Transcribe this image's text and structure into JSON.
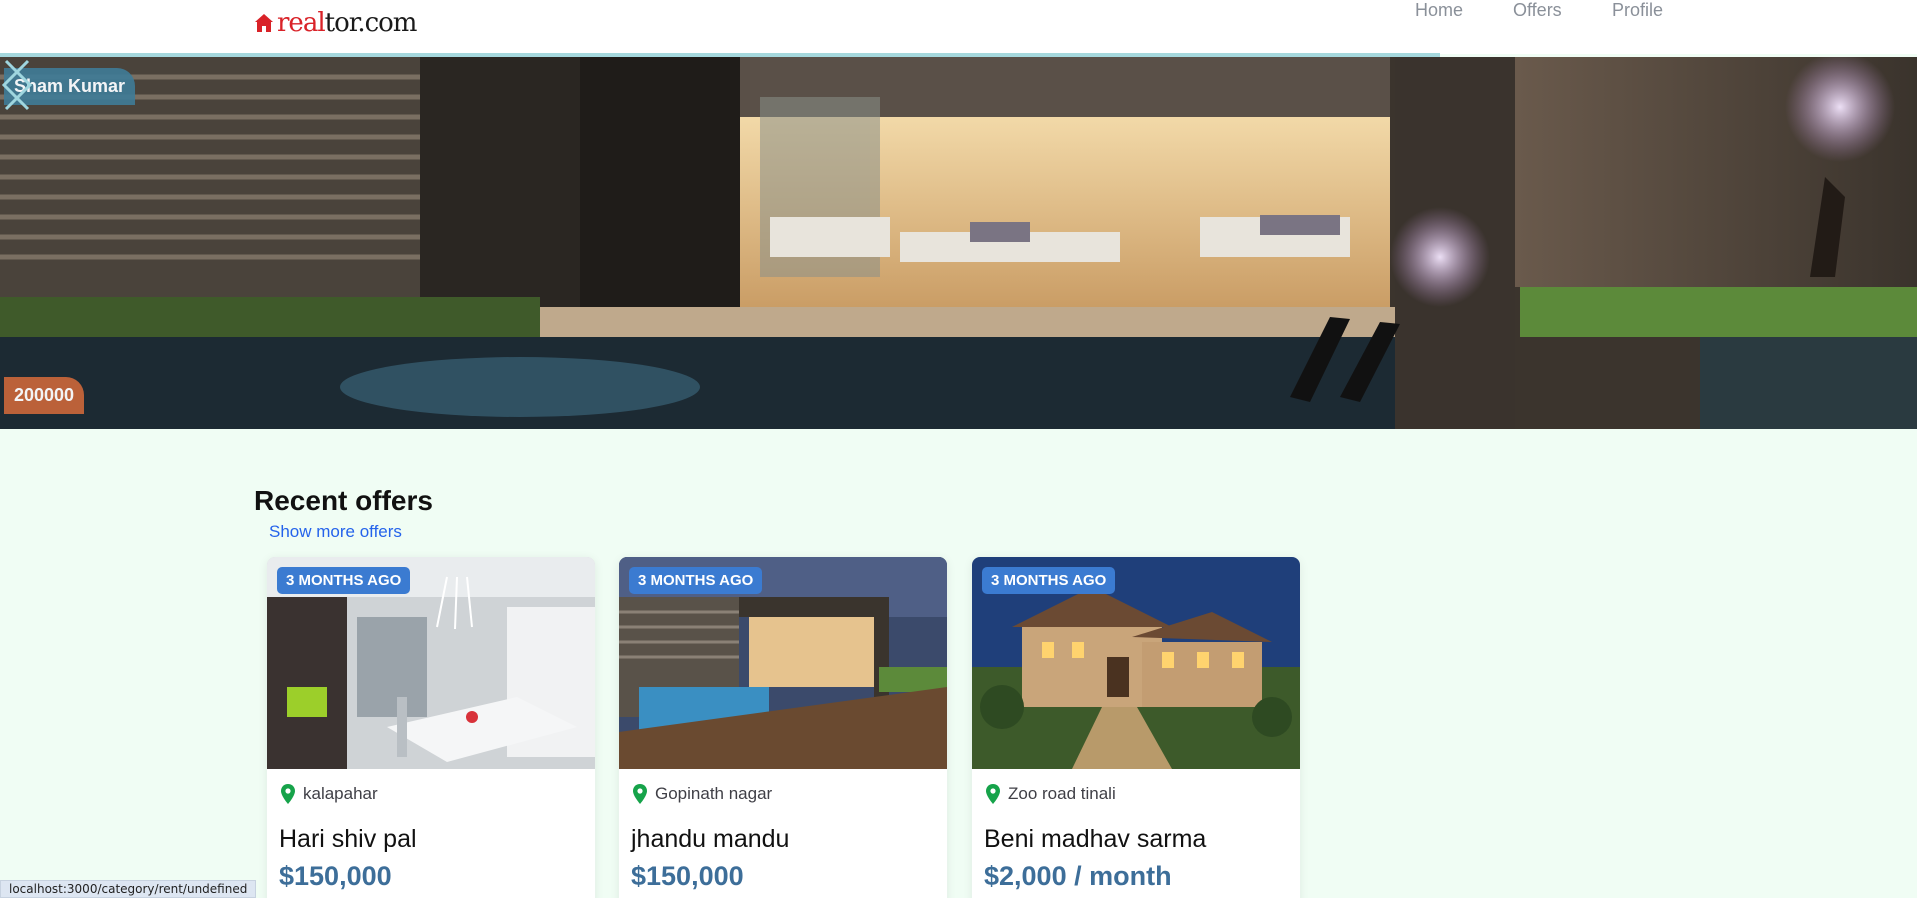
{
  "header": {
    "logo_red": "real",
    "logo_dark": "tor.com",
    "nav": [
      "Home",
      "Offers",
      "Profile"
    ]
  },
  "hero": {
    "name_tag": "Sham Kumar",
    "price_tag": "200000",
    "prev_icon": "chevron-left-icon",
    "next_icon": "chevron-right-icon"
  },
  "offers": {
    "title": "Recent offers",
    "more_link": "Show more offers",
    "cards": [
      {
        "badge": "3 MONTHS AGO",
        "location": "kalapahar",
        "name": "Hari shiv pal",
        "price": "$150,000"
      },
      {
        "badge": "3 MONTHS AGO",
        "location": "Gopinath nagar",
        "name": "jhandu mandu",
        "price": "$150,000"
      },
      {
        "badge": "3 MONTHS AGO",
        "location": "Zoo road tinali",
        "name": "Beni madhav sarma",
        "price": "$2,000 / month"
      }
    ]
  },
  "status_bar": {
    "url": "localhost:3000/category/rent/undefined"
  },
  "colors": {
    "accent": "#3b7bd1",
    "price": "#3d6e99",
    "brand_red": "#d92228",
    "page_bg": "#f0fdf4"
  }
}
